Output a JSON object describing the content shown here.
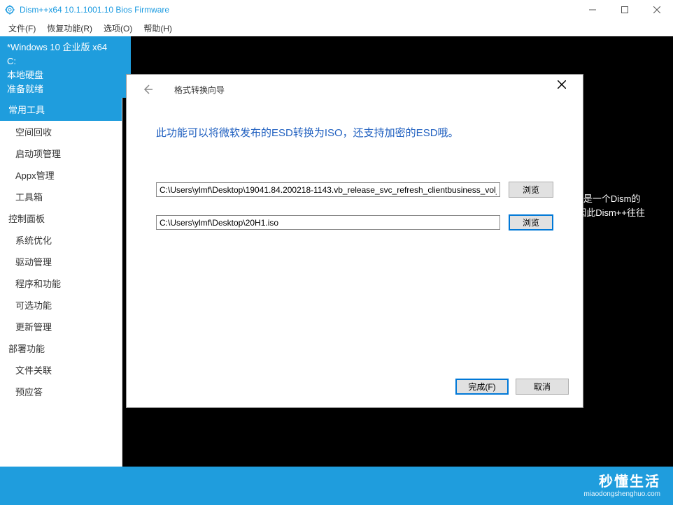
{
  "titlebar": {
    "text": "Dism++x64 10.1.1001.10 Bios Firmware"
  },
  "menu": {
    "file": "文件(F)",
    "recovery": "恢复功能(R)",
    "options": "选项(O)",
    "help": "帮助(H)"
  },
  "info": {
    "os": "*Windows 10 企业版 x64",
    "drive": "C:",
    "disk": "本地硬盘",
    "status": "准备就绪"
  },
  "sidebar": {
    "section1": "常用工具",
    "items1": [
      "空间回收",
      "启动项管理",
      "Appx管理",
      "工具箱"
    ],
    "section2": "控制面板",
    "items2": [
      "系统优化",
      "驱动管理",
      "程序和功能",
      "可选功能",
      "更新管理"
    ],
    "section3": "部署功能",
    "items3": [
      "文件关联",
      "预应答"
    ]
  },
  "content": {
    "hint1": "++可以说是一个Dism的",
    "hint2": "ence)。因此Dism++往往"
  },
  "dialog": {
    "title": "格式转换向导",
    "desc": "此功能可以将微软发布的ESD转换为ISO，还支持加密的ESD哦。",
    "path1": "C:\\Users\\ylmf\\Desktop\\19041.84.200218-1143.vb_release_svc_refresh_clientbusiness_vol_",
    "path2": "C:\\Users\\ylmf\\Desktop\\20H1.iso",
    "browse": "浏览",
    "finish": "完成(F)",
    "cancel": "取消"
  },
  "watermark": {
    "main": "秒懂生活",
    "sub": "miaodongshenghuo.com"
  }
}
